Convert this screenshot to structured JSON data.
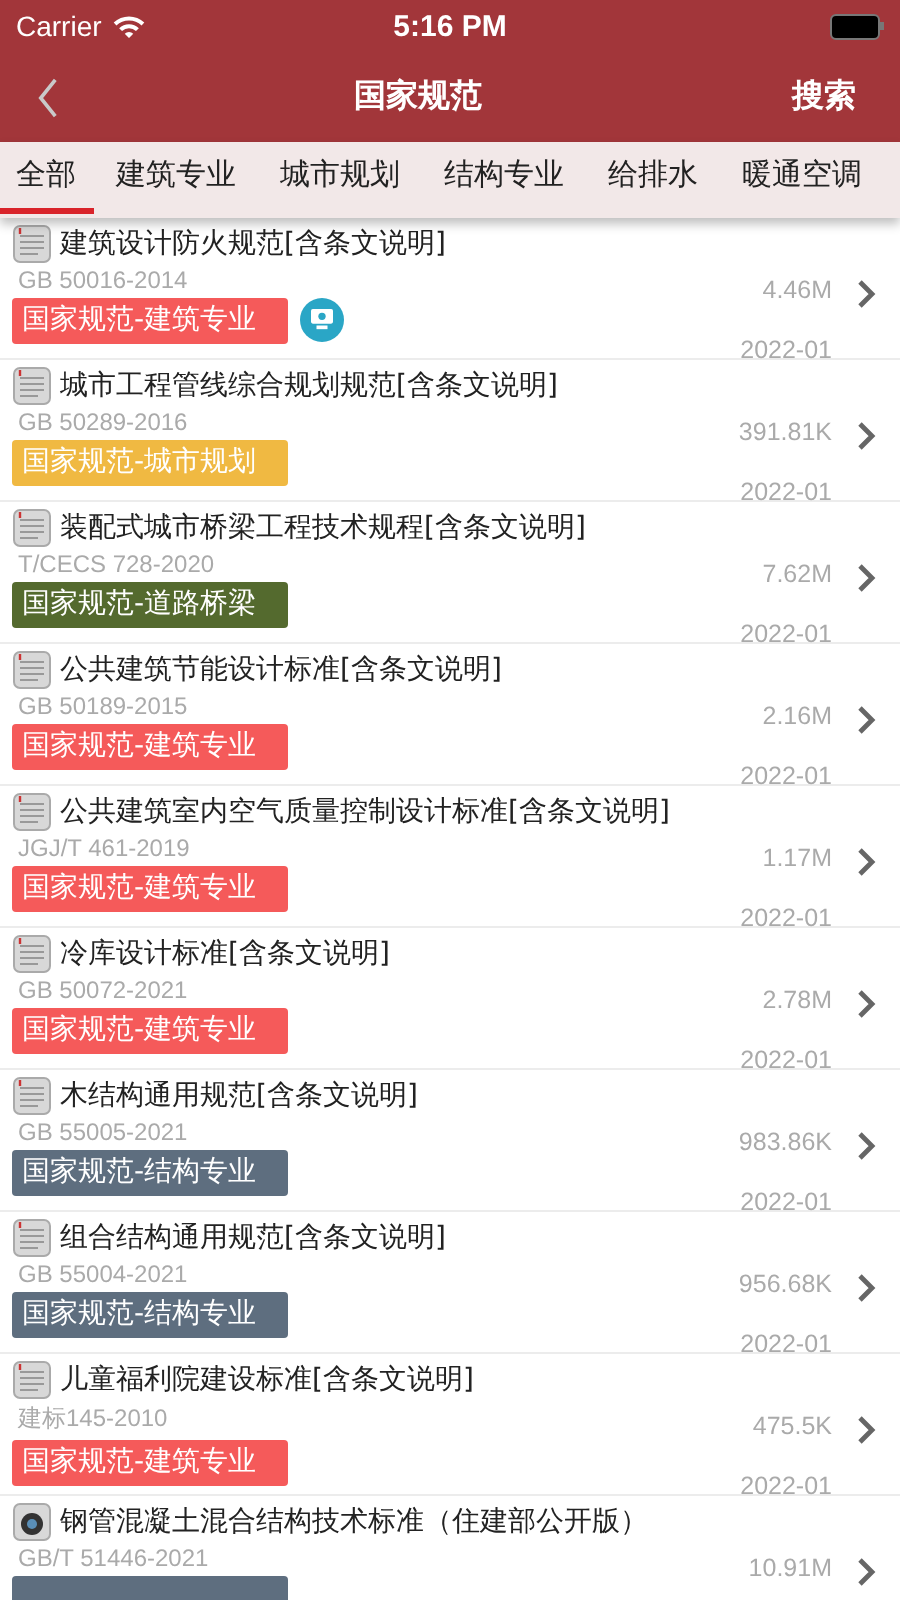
{
  "status_bar": {
    "carrier": "Carrier",
    "time": "5:16 PM"
  },
  "nav": {
    "title": "国家规范",
    "action": "搜索"
  },
  "tabs": [
    {
      "label": "全部",
      "selected": true
    },
    {
      "label": "建筑专业",
      "selected": false
    },
    {
      "label": "城市规划",
      "selected": false
    },
    {
      "label": "结构专业",
      "selected": false
    },
    {
      "label": "给排水",
      "selected": false
    },
    {
      "label": "暖通空调",
      "selected": false
    }
  ],
  "items": [
    {
      "kind": "doc",
      "title": "建筑设计防火规范[含条文说明]",
      "code": "GB 50016-2014",
      "tag": "国家规范-建筑专业",
      "color": "#f55a5a",
      "size": "4.46M",
      "date": "2022-01",
      "badge": true
    },
    {
      "kind": "doc",
      "title": "城市工程管线综合规划规范[含条文说明]",
      "code": "GB 50289-2016",
      "tag": "国家规范-城市规划",
      "color": "#f0b942",
      "size": "391.81K",
      "date": "2022-01",
      "badge": false
    },
    {
      "kind": "doc",
      "title": "装配式城市桥梁工程技术规程[含条文说明]",
      "code": "T/CECS 728-2020",
      "tag": "国家规范-道路桥梁",
      "color": "#546a2e",
      "size": "7.62M",
      "date": "2022-01",
      "badge": false
    },
    {
      "kind": "doc",
      "title": "公共建筑节能设计标准[含条文说明]",
      "code": "GB 50189-2015",
      "tag": "国家规范-建筑专业",
      "color": "#f55a5a",
      "size": "2.16M",
      "date": "2022-01",
      "badge": false
    },
    {
      "kind": "doc",
      "title": "公共建筑室内空气质量控制设计标准[含条文说明]",
      "code": "JGJ/T 461-2019",
      "tag": "国家规范-建筑专业",
      "color": "#f55a5a",
      "size": "1.17M",
      "date": "2022-01",
      "badge": false
    },
    {
      "kind": "doc",
      "title": "冷库设计标准[含条文说明]",
      "code": "GB 50072-2021",
      "tag": "国家规范-建筑专业",
      "color": "#f55a5a",
      "size": "2.78M",
      "date": "2022-01",
      "badge": false
    },
    {
      "kind": "doc",
      "title": "木结构通用规范[含条文说明]",
      "code": "GB 55005-2021",
      "tag": "国家规范-结构专业",
      "color": "#5e6e7f",
      "size": "983.86K",
      "date": "2022-01",
      "badge": false
    },
    {
      "kind": "doc",
      "title": "组合结构通用规范[含条文说明]",
      "code": "GB 55004-2021",
      "tag": "国家规范-结构专业",
      "color": "#5e6e7f",
      "size": "956.68K",
      "date": "2022-01",
      "badge": false
    },
    {
      "kind": "doc",
      "title": "儿童福利院建设标准[含条文说明]",
      "code": "建标145-2010",
      "tag": "国家规范-建筑专业",
      "color": "#f55a5a",
      "size": "475.5K",
      "date": "2022-01",
      "badge": false
    },
    {
      "kind": "video",
      "title": "钢管混凝土混合结构技术标准（住建部公开版）",
      "code": "GB/T 51446-2021",
      "color": "#5e6e7f",
      "size": "10.91M",
      "badge": false
    }
  ]
}
